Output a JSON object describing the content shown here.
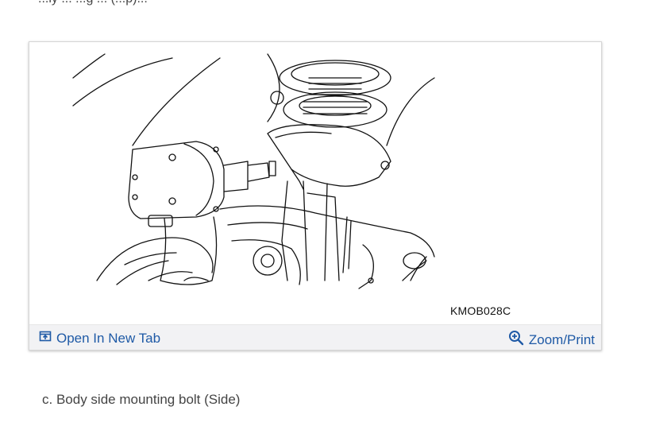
{
  "page": {
    "top_cut_text": "...ly ... ...g ... (...p)..."
  },
  "figure": {
    "code": "KMOB028C",
    "image_name": "technical-line-drawing-strut-mount-impact-wrench",
    "toolbar": {
      "open_label": "Open In New Tab",
      "zoom_label": "Zoom/Print",
      "open_icon": "open-new-tab-icon",
      "zoom_icon": "zoom-magnifier-icon"
    }
  },
  "caption": {
    "text": "c. Body side mounting bolt (Side)"
  },
  "colors": {
    "link": "#1f5aa6",
    "toolbar_bg": "#f2f2f4",
    "line_art": "#111111"
  }
}
